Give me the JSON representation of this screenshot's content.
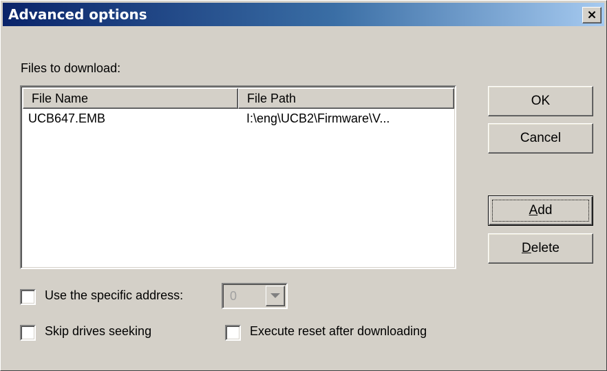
{
  "window": {
    "title": "Advanced options",
    "close_label": "×"
  },
  "files_section": {
    "label": "Files to download:",
    "columns": [
      "File Name",
      "File Path"
    ],
    "rows": [
      {
        "name": "UCB647.EMB",
        "path": "I:\\eng\\UCB2\\Firmware\\V..."
      }
    ]
  },
  "buttons": {
    "ok": "OK",
    "cancel": "Cancel",
    "add_mnemonic": "A",
    "add_rest": "dd",
    "delete_mnemonic": "D",
    "delete_rest": "elete"
  },
  "options": {
    "specific_address": {
      "label": "Use the specific address:",
      "checked": false,
      "value": "0",
      "enabled": false
    },
    "skip_drives": {
      "label": "Skip drives seeking",
      "checked": false
    },
    "execute_reset": {
      "label": "Execute reset after downloading",
      "checked": false
    }
  },
  "icons": {
    "combo_arrow": "chevron-down-icon",
    "close": "close-icon"
  }
}
